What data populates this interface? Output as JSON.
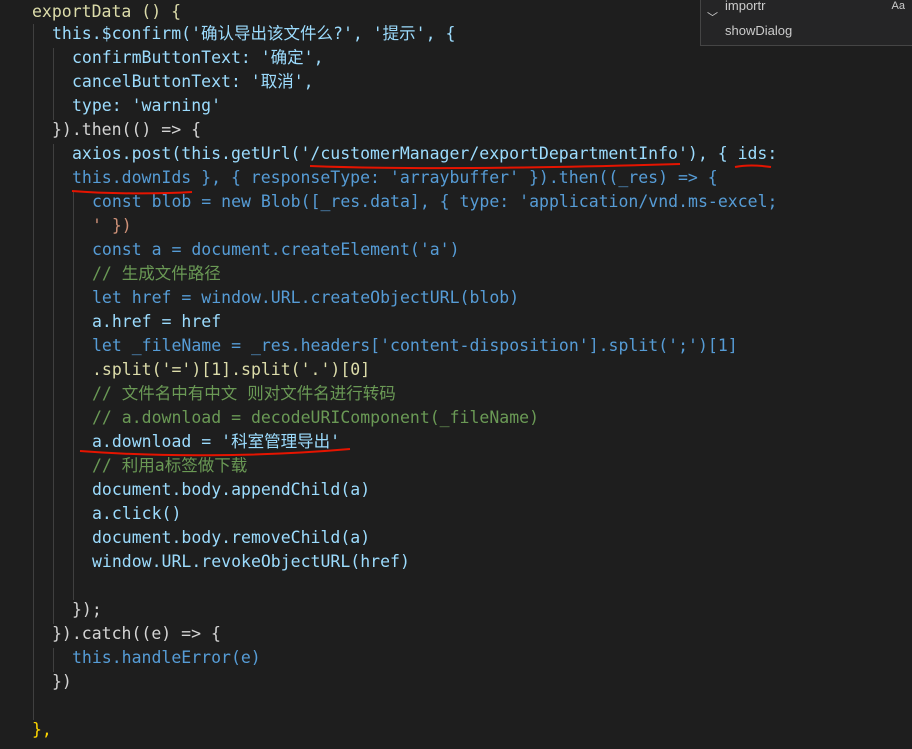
{
  "code_lines": [
    [
      "exportData () {"
    ],
    [
      "this.$confirm('确认导出该文件么?', '提示', {"
    ],
    [
      "confirmButtonText: '确定',"
    ],
    [
      "cancelButtonText: '取消',"
    ],
    [
      "type: 'warning'"
    ],
    [
      "}).then(() => {"
    ],
    [
      "axios.post(this.getUrl('/customerManager/exportDepartmentInfo'), { ids:"
    ],
    [
      "this.downIds }, { responseType: 'arraybuffer' }).then((_res) => {"
    ],
    [
      "const blob = new Blob([_res.data], { type: 'application/vnd.ms-excel;"
    ],
    [
      "' })"
    ],
    [
      "const a = document.createElement('a')"
    ],
    [
      "// 生成文件路径"
    ],
    [
      "let href = window.URL.createObjectURL(blob)"
    ],
    [
      "a.href = href"
    ],
    [
      "let _fileName = _res.headers['content-disposition'].split(';')[1]"
    ],
    [
      ".split('=')[1].split('.')[0]"
    ],
    [
      "// 文件名中有中文 则对文件名进行转码"
    ],
    [
      "// a.download = decodeURIComponent(_fileName)"
    ],
    [
      "a.download = '科室管理导出'"
    ],
    [
      "// 利用a标签做下载"
    ],
    [
      "document.body.appendChild(a)"
    ],
    [
      "a.click()"
    ],
    [
      "document.body.removeChild(a)"
    ],
    [
      "window.URL.revokeObjectURL(href)"
    ],
    [
      ""
    ],
    [
      "});"
    ],
    [
      "}).catch((e) => {"
    ],
    [
      "this.handleError(e)"
    ],
    [
      "})"
    ],
    [
      ""
    ],
    [
      "},"
    ]
  ],
  "suggest_widget": {
    "items": [
      {
        "label": "importr",
        "badge": "Aa"
      },
      {
        "label": "showDialog",
        "badge": ""
      }
    ]
  },
  "colors": {
    "background": "#1e1e1e",
    "keyword": "#569cd6",
    "function": "#dcdcaa",
    "variable": "#9cdcfe",
    "string": "#ce9178",
    "comment": "#6a9955",
    "class": "#4ec9b0",
    "annotation_ink": "#e51400"
  }
}
